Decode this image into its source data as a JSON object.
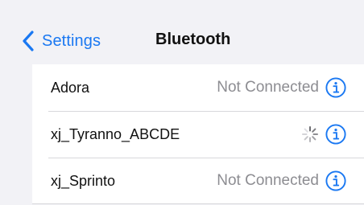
{
  "nav": {
    "back_label": "Settings",
    "title": "Bluetooth",
    "back_icon": "chevron-left-icon"
  },
  "devices": [
    {
      "name": "Adora",
      "status": "Not Connected",
      "connecting": false
    },
    {
      "name": "xj_Tyranno_ABCDE",
      "status": "",
      "connecting": true
    },
    {
      "name": "xj_Sprinto",
      "status": "Not Connected",
      "connecting": false
    }
  ],
  "colors": {
    "accent": "#1a78f2",
    "status_text": "#8d8d92",
    "background": "#f2f2f6",
    "cell_background": "#ffffff"
  },
  "icons": {
    "info": "info-circle-icon",
    "spinner": "activity-spinner-icon"
  }
}
